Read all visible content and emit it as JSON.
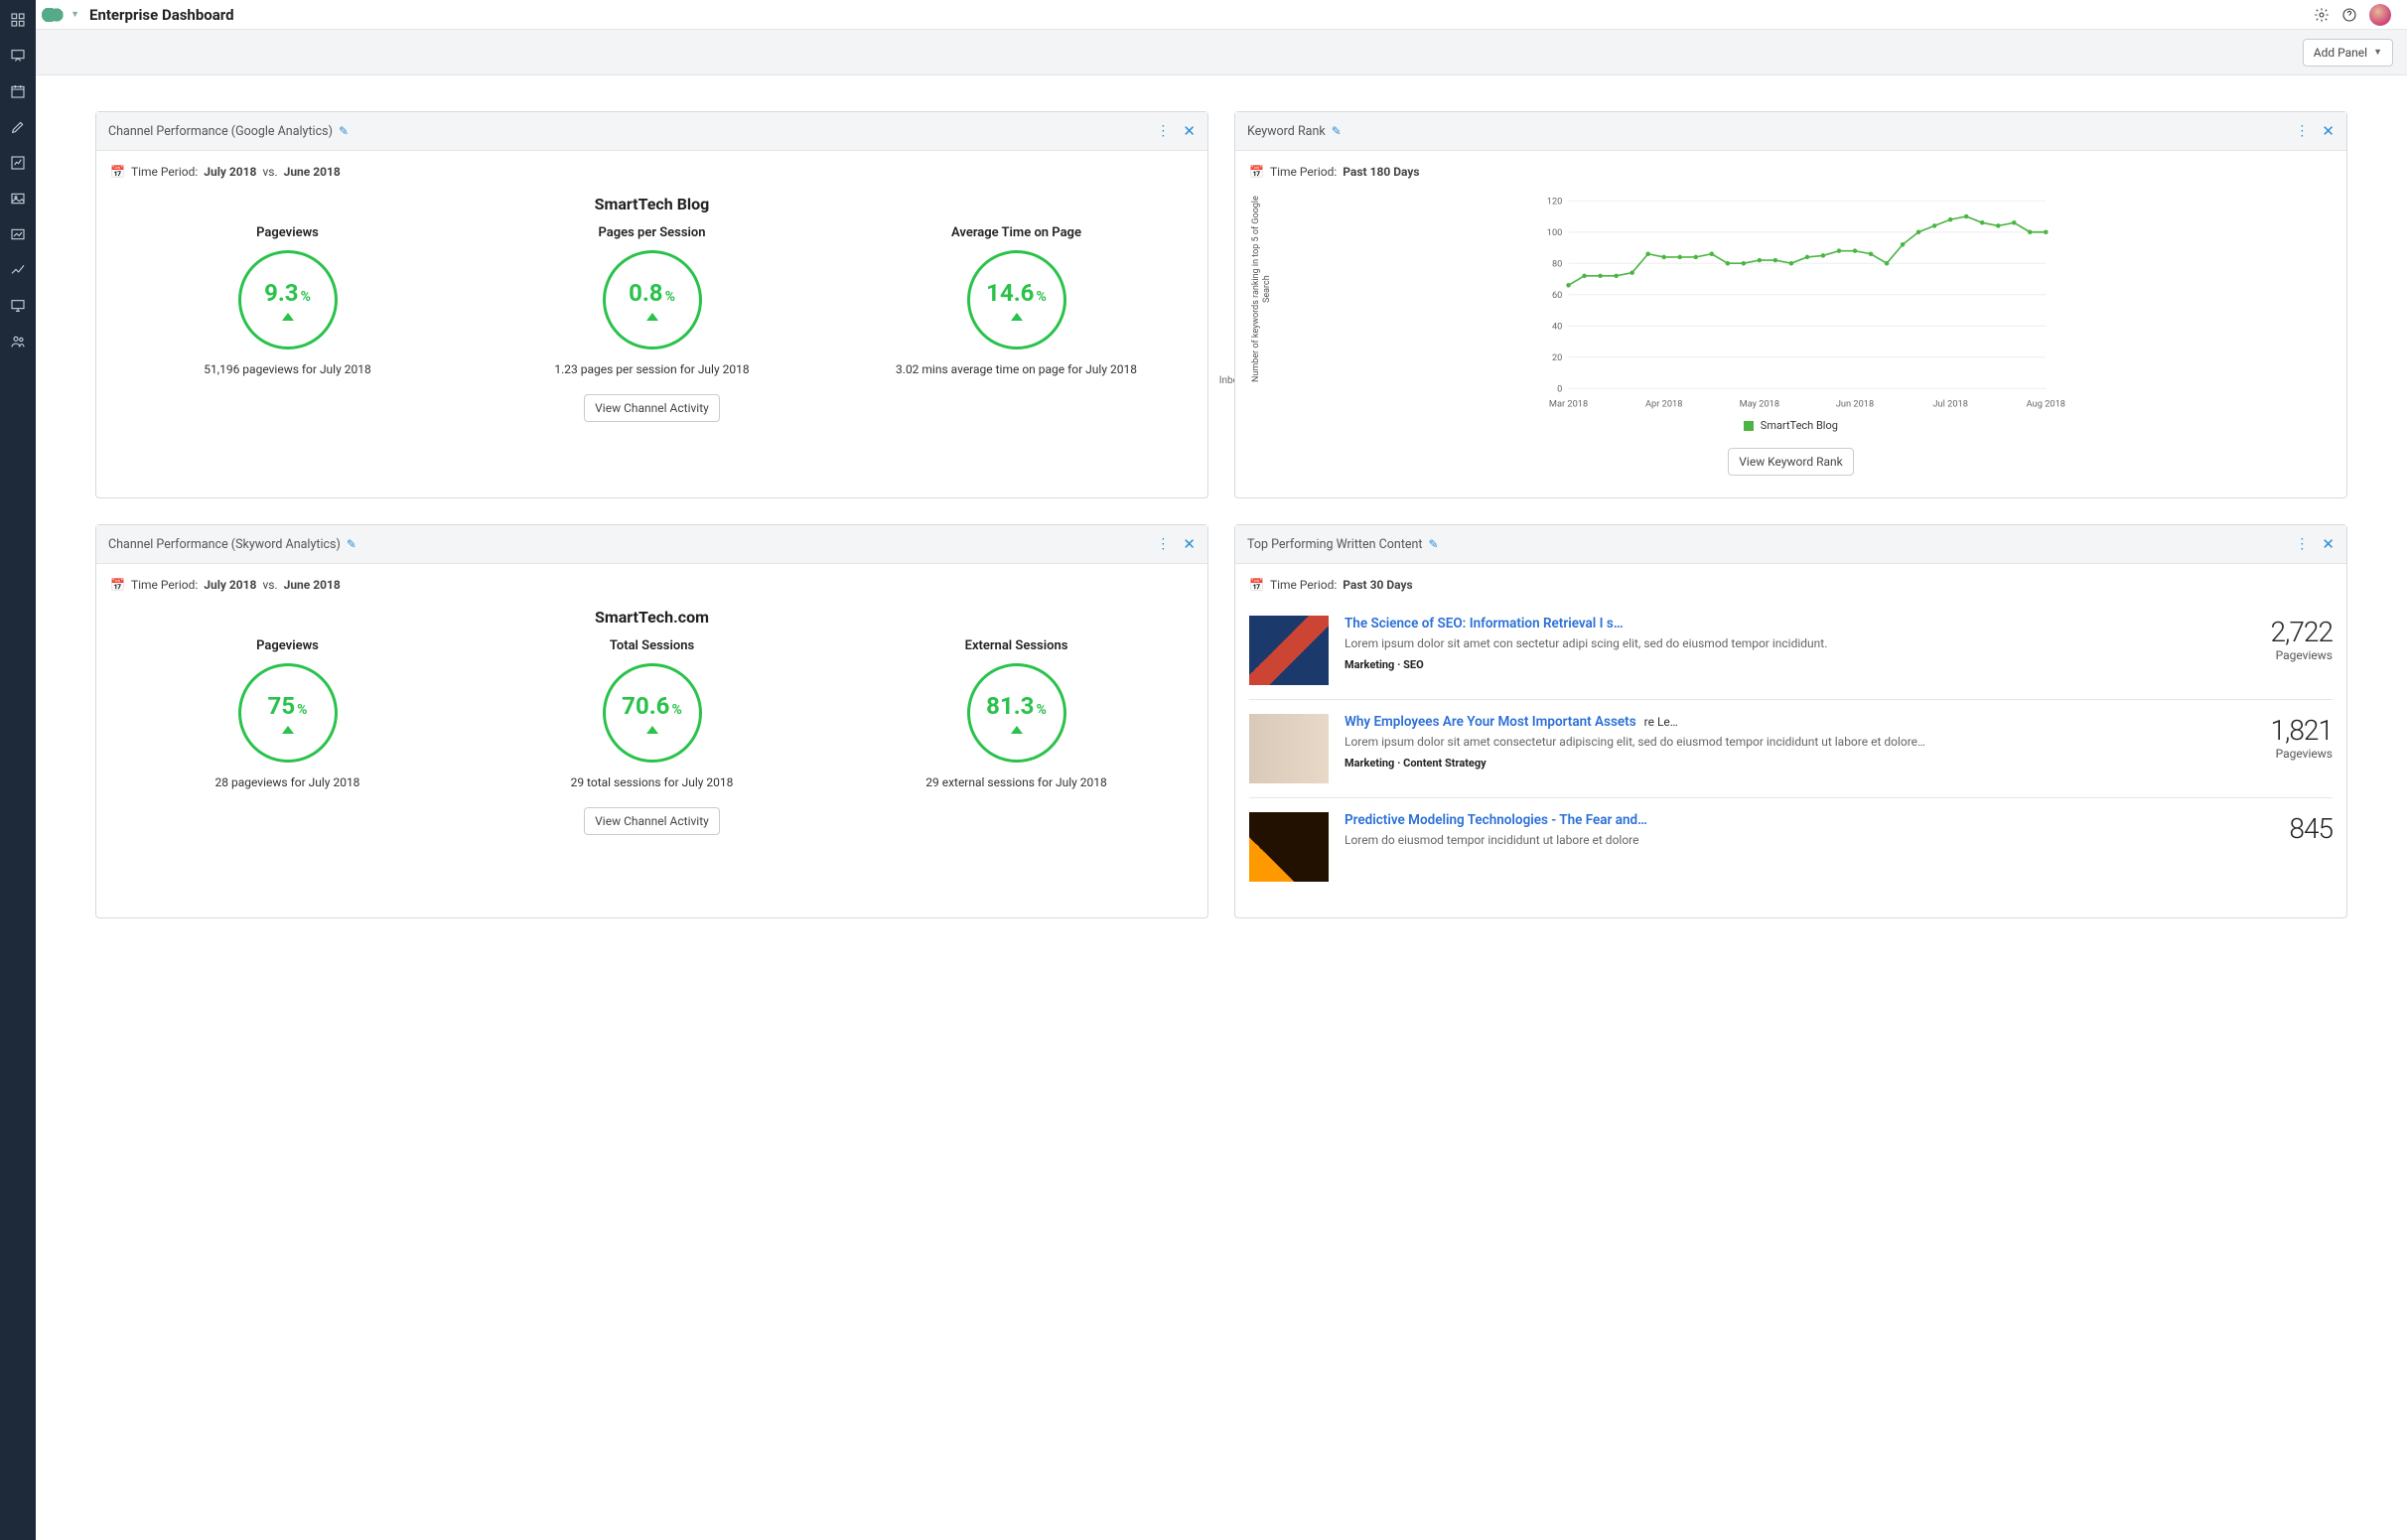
{
  "header": {
    "title": "Enterprise Dashboard"
  },
  "subbar": {
    "add_panel": "Add Panel"
  },
  "rail": {
    "icons": [
      "dashboard",
      "presentation",
      "calendar",
      "pencil",
      "chart-edit",
      "image",
      "photo",
      "trend",
      "monitor",
      "users"
    ]
  },
  "panels": {
    "ga": {
      "title": "Channel Performance (Google Analytics)",
      "period_prefix": "Time Period:",
      "period_a": "July 2018",
      "period_vs": "vs.",
      "period_b": "June 2018",
      "subject": "SmartTech Blog",
      "inbound": "Inbound",
      "gauges": [
        {
          "label": "Pageviews",
          "value": "9.3",
          "caption": "51,196 pageviews for July 2018"
        },
        {
          "label": "Pages per Session",
          "value": "0.8",
          "caption": "1.23 pages per session for July 2018"
        },
        {
          "label": "Average Time on Page",
          "value": "14.6",
          "caption": "3.02 mins average time on page for July 2018"
        }
      ],
      "cta": "View Channel Activity"
    },
    "kw": {
      "title": "Keyword Rank",
      "period_prefix": "Time Period:",
      "period_val": "Past 180 Days",
      "ylabel": "Number of keywords ranking in top 5 of Google Search",
      "legend": "SmartTech Blog",
      "cta": "View Keyword Rank"
    },
    "sky": {
      "title": "Channel Performance (Skyword Analytics)",
      "period_prefix": "Time Period:",
      "period_a": "July 2018",
      "period_vs": "vs.",
      "period_b": "June 2018",
      "subject": "SmartTech.com",
      "gauges": [
        {
          "label": "Pageviews",
          "value": "75",
          "caption": "28 pageviews for July 2018"
        },
        {
          "label": "Total Sessions",
          "value": "70.6",
          "caption": "29 total sessions for July 2018"
        },
        {
          "label": "External Sessions",
          "value": "81.3",
          "caption": "29 external sessions for July 2018"
        }
      ],
      "cta": "View Channel Activity"
    },
    "top": {
      "title": "Top Performing Written Content",
      "period_prefix": "Time Period:",
      "period_val": "Past 30 Days",
      "posts": [
        {
          "title": "The Science of SEO: Information Retrieval I s…",
          "desc": "Lorem ipsum dolor sit amet con sectetur adipi scing elit, sed do eiusmod tempor incididunt.",
          "meta": "Marketing · SEO",
          "value": "2,722",
          "unit": "Pageviews"
        },
        {
          "title": "Why Employees Are Your Most Important Assets",
          "trail": "re Le…",
          "desc": "Lorem ipsum dolor sit amet consectetur adipiscing elit, sed do eiusmod tempor incididunt ut labore et dolore…",
          "meta": "Marketing · Content Strategy",
          "value": "1,821",
          "unit": "Pageviews"
        },
        {
          "title": "Predictive Modeling Technologies - The Fear and…",
          "desc": "Lorem do eiusmod tempor incididunt ut labore et dolore",
          "meta": "",
          "value": "845",
          "unit": ""
        }
      ]
    }
  },
  "chart_data": {
    "type": "line",
    "title": "Keyword Rank",
    "xlabel": "",
    "ylabel": "Number of keywords ranking in top 5 of Google Search",
    "ylim": [
      0,
      120
    ],
    "yticks": [
      0,
      20,
      40,
      60,
      80,
      100,
      120
    ],
    "categories": [
      "Mar 2018",
      "Apr 2018",
      "May 2018",
      "Jun 2018",
      "Jul 2018",
      "Aug 2018"
    ],
    "series": [
      {
        "name": "SmartTech Blog",
        "color": "#4bb543",
        "values": [
          66,
          72,
          72,
          72,
          74,
          86,
          84,
          84,
          84,
          86,
          80,
          80,
          82,
          82,
          80,
          84,
          85,
          88,
          88,
          86,
          80,
          92,
          100,
          104,
          108,
          110,
          106,
          104,
          106,
          100,
          100
        ]
      }
    ]
  }
}
